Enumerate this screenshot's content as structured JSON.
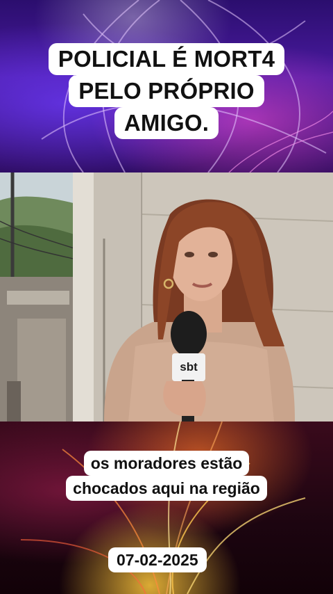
{
  "headline": {
    "lines": [
      "POLICIAL É MORT4",
      "PELO PRÓPRIO",
      "AMIGO."
    ]
  },
  "video": {
    "mic_logo": "sbt"
  },
  "caption": {
    "lines": [
      "os moradores estão",
      "chocados aqui na região"
    ]
  },
  "date": "07-02-2025",
  "colors": {
    "top_background": "#4a1aa0",
    "bottom_background": "#3a0a1c",
    "label_background": "#ffffff",
    "label_text": "#111111"
  }
}
